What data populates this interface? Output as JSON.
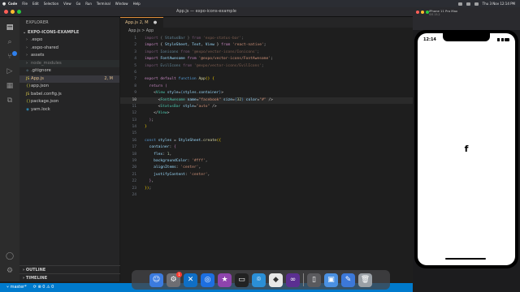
{
  "menubar": {
    "items": [
      "Code",
      "File",
      "Edit",
      "Selection",
      "View",
      "Go",
      "Run",
      "Terminal",
      "Window",
      "Help"
    ],
    "clock": "Thu 3 Nov 12:14 PM"
  },
  "window": {
    "title": "App.js — expo-icons-example"
  },
  "sidebar": {
    "header": "EXPLORER",
    "project": "EXPO-ICONS-EXAMPLE",
    "files": [
      {
        "name": ".expo",
        "type": "folder",
        "dim": false
      },
      {
        "name": ".expo-shared",
        "type": "folder",
        "dim": false
      },
      {
        "name": "assets",
        "type": "folder",
        "dim": false
      },
      {
        "name": "node_modules",
        "type": "folder",
        "dim": true
      },
      {
        "name": ".gitignore",
        "type": "file",
        "dim": false
      },
      {
        "name": "App.js",
        "type": "file",
        "dim": false,
        "status": "2, M",
        "selected": true
      },
      {
        "name": "app.json",
        "type": "file",
        "dim": false
      },
      {
        "name": "babel.config.js",
        "type": "file",
        "dim": false
      },
      {
        "name": "package.json",
        "type": "file",
        "dim": false
      },
      {
        "name": "yarn.lock",
        "type": "file",
        "dim": false
      }
    ],
    "outline": "OUTLINE",
    "timeline": "TIMELINE"
  },
  "editor": {
    "tab_label": "App.js 2, M",
    "breadcrumb": "App.js > App",
    "current_line": 10,
    "line_numbers": [
      "1",
      "2",
      "3",
      "4",
      "5",
      "6",
      "7",
      "8",
      "9",
      "10",
      "11",
      "12",
      "13",
      "14",
      "15",
      "16",
      "17",
      "18",
      "19",
      "20",
      "21",
      "22",
      "23",
      "24"
    ]
  },
  "statusbar": {
    "branch": "master*",
    "sync": "⟳ ⊗ 0 ⚠ 0"
  },
  "simulator": {
    "title": "iPhone 11 Pro Max",
    "subtitle": "iOS 15.2",
    "phone_time": "12:14",
    "icon": "f"
  },
  "colors": {
    "accent": "#007acc",
    "tab_modified": "#e2c08d"
  }
}
